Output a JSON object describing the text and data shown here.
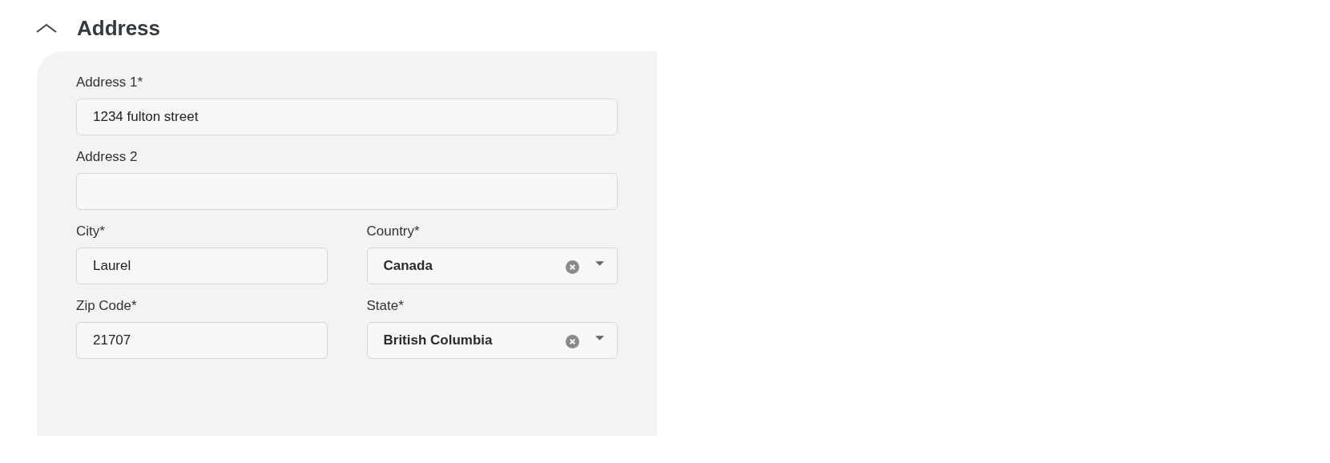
{
  "section": {
    "title": "Address",
    "expanded": true
  },
  "rows": [
    {
      "fields": [
        {
          "kind": "text",
          "label": "Address 1*",
          "value": "1234 fulton street"
        }
      ]
    },
    {
      "fields": [
        {
          "kind": "text",
          "label": "Address 2"
        }
      ]
    },
    {
      "fields": [
        {
          "kind": "text",
          "label": "City*",
          "value": "Laurel"
        },
        {
          "kind": "select",
          "label": "Country*",
          "value": "Canada"
        }
      ]
    },
    {
      "fields": [
        {
          "kind": "text",
          "label": "Zip Code*",
          "value": "21707"
        },
        {
          "kind": "select",
          "label": "State*",
          "value": "British Columbia"
        }
      ]
    }
  ]
}
